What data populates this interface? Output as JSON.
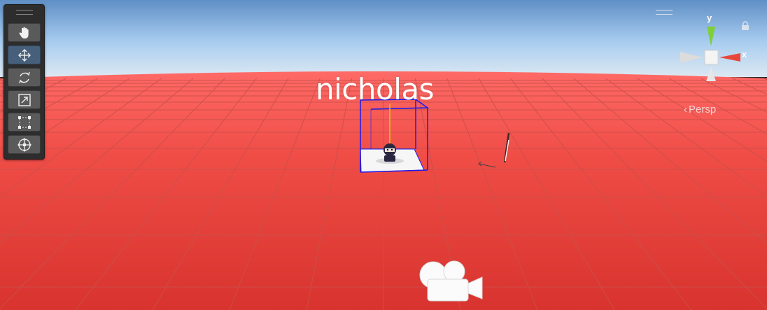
{
  "scene": {
    "object_label": "nicholas",
    "view_mode": "Persp",
    "axis_x": "x",
    "axis_y": "y",
    "ground_color": "#e7463f",
    "sky_color": "#9fc6ea"
  },
  "toolbar": {
    "tools": [
      {
        "name": "hand-tool",
        "icon": "hand-icon"
      },
      {
        "name": "move-tool",
        "icon": "move-icon",
        "active": true
      },
      {
        "name": "rotate-tool",
        "icon": "rotate-icon"
      },
      {
        "name": "scale-tool",
        "icon": "scale-icon"
      },
      {
        "name": "rect-tool",
        "icon": "rect-transform-icon"
      },
      {
        "name": "transform-tool",
        "icon": "transform-icon"
      }
    ]
  },
  "icons": [
    "lock-icon",
    "camera-icon",
    "light-icon"
  ]
}
